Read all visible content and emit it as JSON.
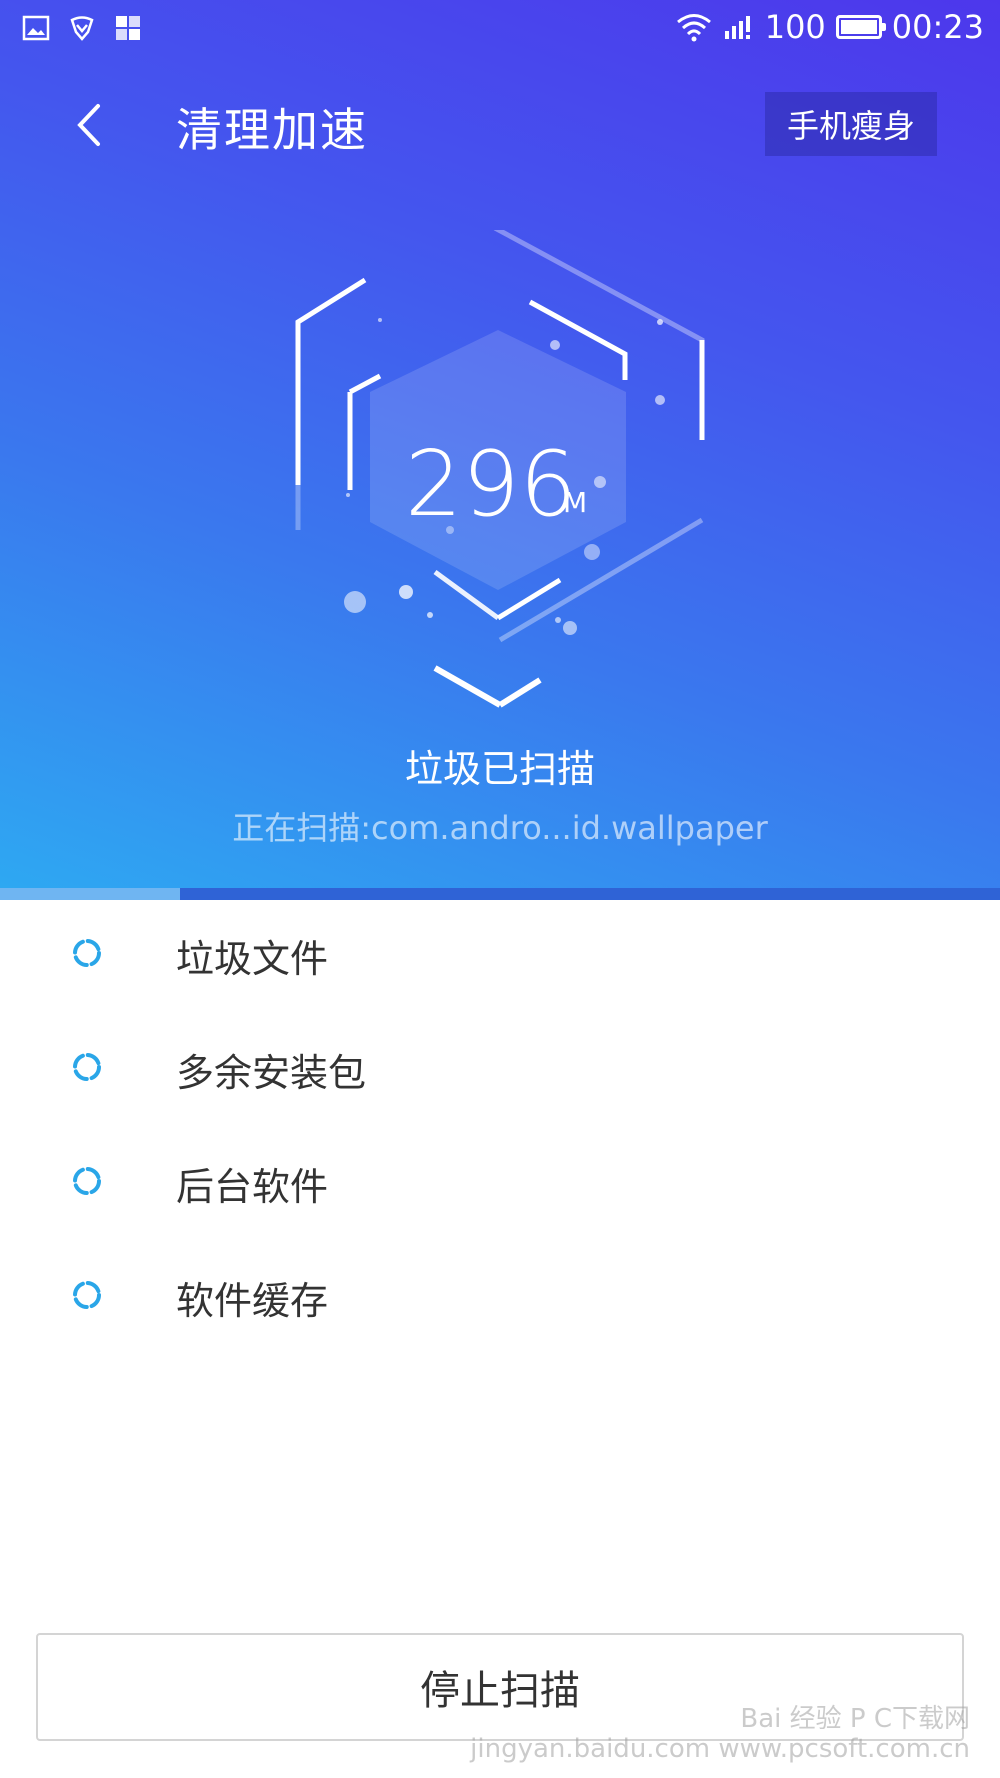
{
  "status_bar": {
    "battery_level": "100",
    "battery_percent": 100,
    "time": "00:23",
    "left_icons": [
      "gallery-icon",
      "shield-icon",
      "apps-grid-icon"
    ],
    "right_icons": [
      "wifi-icon",
      "signal-icon",
      "battery-icon"
    ]
  },
  "header": {
    "title": "清理加速",
    "right_button": "手机瘦身"
  },
  "scan": {
    "size_value": "296",
    "size_unit": "M",
    "status_label": "垃圾已扫描",
    "current_path": "正在扫描:com.andro...id.wallpaper",
    "progress": 0.18
  },
  "items": [
    {
      "label": "垃圾文件"
    },
    {
      "label": "多余安装包"
    },
    {
      "label": "后台软件"
    },
    {
      "label": "软件缓存"
    }
  ],
  "footer": {
    "stop_button": "停止扫描"
  },
  "watermark": {
    "line1": "Bai 经验 P C下载网",
    "line2": "jingyan.baidu.com www.pcsoft.com.cn"
  },
  "colors": {
    "gradient_top": "#4d37ec",
    "gradient_bottom": "#2ea8f2",
    "spinner": "#2aa6e8"
  }
}
